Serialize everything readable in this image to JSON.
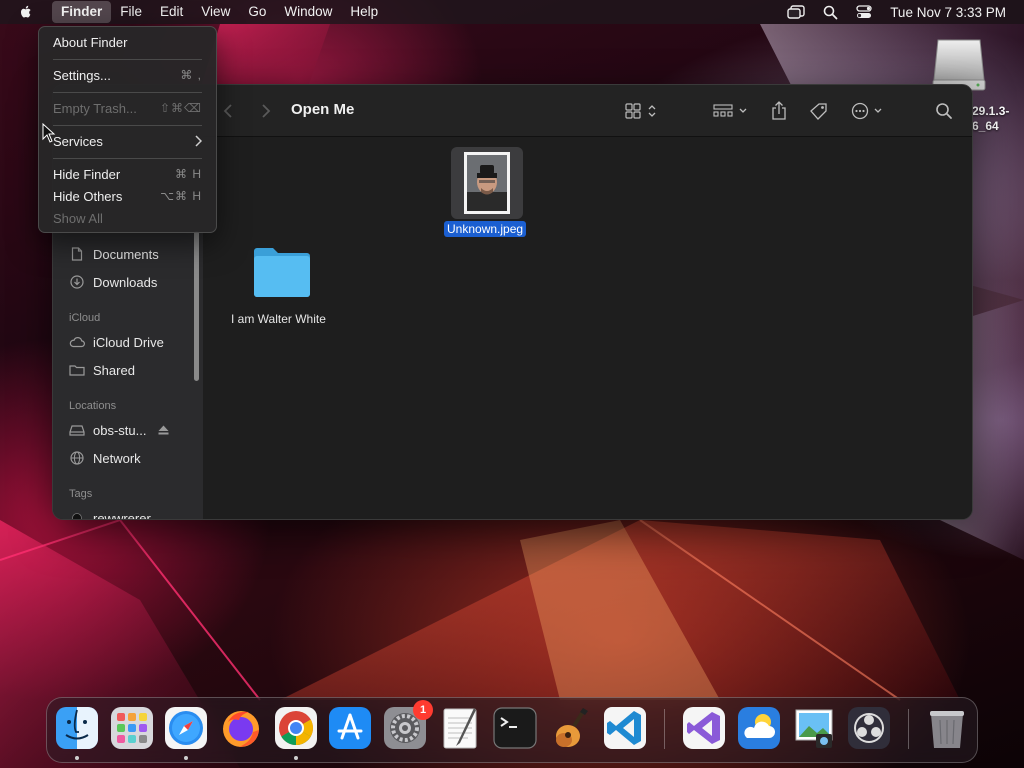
{
  "menubar": {
    "items": [
      {
        "label": "Finder",
        "active": true
      },
      {
        "label": "File"
      },
      {
        "label": "Edit"
      },
      {
        "label": "View"
      },
      {
        "label": "Go"
      },
      {
        "label": "Window"
      },
      {
        "label": "Help"
      }
    ],
    "clock": "Tue Nov 7  3:33 PM"
  },
  "desktop": {
    "volume_label": "29.1.3-6_64"
  },
  "finder_menu": {
    "items": [
      {
        "label": "About Finder",
        "shortcut": ""
      },
      {
        "label": "Settings...",
        "shortcut": "⌘ ,"
      },
      {
        "label": "Empty Trash...",
        "shortcut": "⇧⌘⌫",
        "disabled": true
      },
      {
        "label": "Services",
        "shortcut": ">"
      },
      {
        "label": "Hide Finder",
        "shortcut": "⌘ H"
      },
      {
        "label": "Hide Others",
        "shortcut": "⌥⌘ H"
      },
      {
        "label": "Show All",
        "shortcut": "",
        "disabled": true
      }
    ]
  },
  "window": {
    "title": "Open Me",
    "sidebar": {
      "items": [
        {
          "label": "Documents",
          "icon": "document-icon"
        },
        {
          "label": "Downloads",
          "icon": "download-icon"
        },
        {
          "section": "iCloud"
        },
        {
          "label": "iCloud Drive",
          "icon": "cloud-icon"
        },
        {
          "label": "Shared",
          "icon": "shared-folder-icon"
        },
        {
          "section": "Locations"
        },
        {
          "label": "obs-stu...",
          "icon": "disk-icon"
        },
        {
          "label": "Network",
          "icon": "globe-icon"
        },
        {
          "section": "Tags"
        },
        {
          "label": "rewwrerer",
          "icon": "tag-dot-icon"
        }
      ]
    },
    "files": [
      {
        "name": "Unknown.jpeg",
        "kind": "image",
        "selected": true
      },
      {
        "name": "I am Walter White",
        "kind": "folder",
        "selected": false
      }
    ]
  },
  "dock": {
    "apps": [
      {
        "name": "Finder",
        "icon": "finder-icon"
      },
      {
        "name": "Launchpad",
        "icon": "launchpad-icon"
      },
      {
        "name": "Safari",
        "icon": "safari-icon"
      },
      {
        "name": "Firefox",
        "icon": "firefox-icon"
      },
      {
        "name": "Chrome",
        "icon": "chrome-icon"
      },
      {
        "name": "App Store",
        "icon": "app-store-icon"
      },
      {
        "name": "System Settings",
        "icon": "settings-icon",
        "badge": "1"
      },
      {
        "name": "TextEdit",
        "icon": "textedit-icon"
      },
      {
        "name": "Terminal",
        "icon": "terminal-icon"
      },
      {
        "name": "GarageBand",
        "icon": "garageband-icon"
      },
      {
        "name": "VS Code",
        "icon": "vscode-icon"
      },
      {
        "name": "Visual Studio",
        "icon": "visual-studio-icon"
      },
      {
        "name": "Weather",
        "icon": "weather-icon"
      },
      {
        "name": "Preview",
        "icon": "preview-icon"
      },
      {
        "name": "OBS",
        "icon": "obs-icon"
      },
      {
        "name": "Trash",
        "icon": "trash-icon"
      }
    ],
    "colors": {
      "badge": "#ff3b30",
      "selection": "#1b5fd1",
      "folder": "#4fb8f0"
    }
  }
}
